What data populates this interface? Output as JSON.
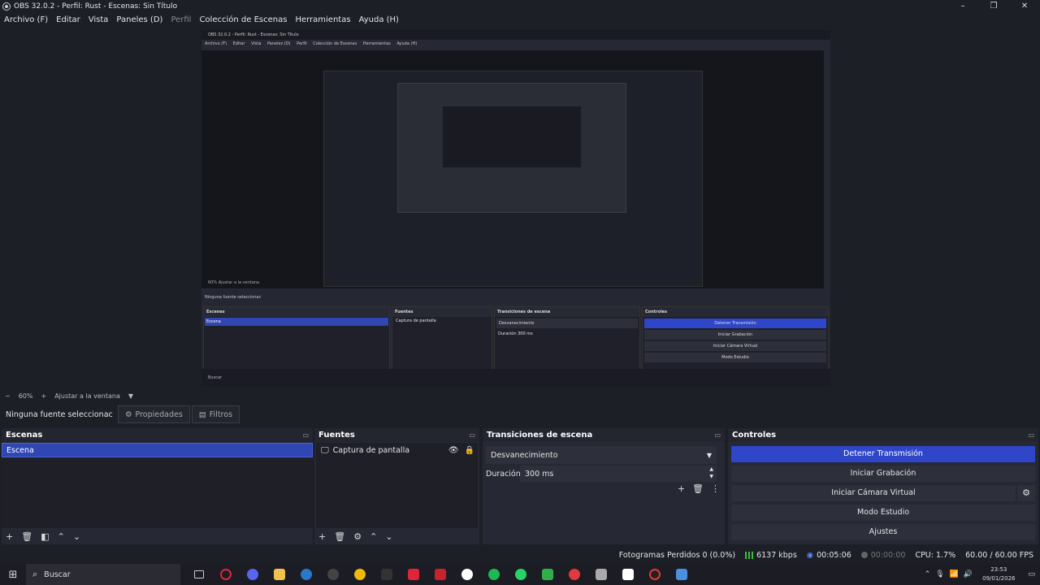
{
  "window": {
    "title": "OBS 32.0.2 - Perfil: Rust - Escenas: Sin Título",
    "minimize": "–",
    "restore": "❐",
    "close": "✕"
  },
  "menu": [
    "Archivo (F)",
    "Editar",
    "Vista",
    "Paneles (D)",
    "Perfil",
    "Colección de Escenas",
    "Herramientas",
    "Ayuda (H)"
  ],
  "zoom": {
    "minus": "−",
    "value": "60%",
    "plus": "+",
    "fit": "Ajustar a la ventana",
    "arrow": "▼"
  },
  "toolbar": {
    "no_source": "Ninguna fuente seleccionac",
    "properties": "Propiedades",
    "filters": "Filtros"
  },
  "scenes": {
    "title": "Escenas",
    "items": [
      "Escena"
    ]
  },
  "sources": {
    "title": "Fuentes",
    "items": [
      {
        "name": "Captura de pantalla"
      }
    ]
  },
  "transitions": {
    "title": "Transiciones de escena",
    "selected": "Desvanecimiento",
    "duration_label": "Duración",
    "duration_value": "300 ms"
  },
  "controls": {
    "title": "Controles",
    "stop_stream": "Detener Transmisión",
    "start_record": "Iniciar Grabación",
    "virtual_cam": "Iniciar Cámara Virtual",
    "studio_mode": "Modo Estudio",
    "settings": "Ajustes"
  },
  "status": {
    "dropped": "Fotogramas Perdidos 0 (0.0%)",
    "bitrate": "6137 kbps",
    "stream_time": "00:05:06",
    "rec_time": "00:00:00",
    "cpu": "CPU: 1.7%",
    "fps": "60.00 / 60.00 FPS"
  },
  "taskbar": {
    "search": "Buscar",
    "time": "23:53",
    "date": "09/01/2026"
  },
  "nested": {
    "title": "OBS 32.0.2 - Perfil: Rust - Escenas: Sin Título",
    "menu": [
      "Archivo (F)",
      "Editar",
      "Vista",
      "Paneles (D)",
      "Perfil",
      "Colección de Escenas",
      "Herramientas",
      "Ayuda (H)"
    ],
    "zoom": "60%   Ajustar a la ventana",
    "no_source": "Ninguna fuente seleccionac",
    "scenes": "Escenas",
    "scene_item": "Escena",
    "sources": "Fuentes",
    "source_item": "Captura de pantalla",
    "transitions": "Transiciones de escena",
    "fade": "Desvanecimiento",
    "duration": "Duración   300 ms",
    "controls": "Controles",
    "stop": "Detener Transmisión",
    "rec": "Iniciar Grabación",
    "vcam": "Iniciar Cámara Virtual",
    "studio": "Modo Estudio",
    "settings": "Ajustes",
    "taskbar": "Buscar"
  },
  "colors": {
    "accent": "#2f46c9",
    "panel": "#262833",
    "bg": "#1d1f27"
  }
}
